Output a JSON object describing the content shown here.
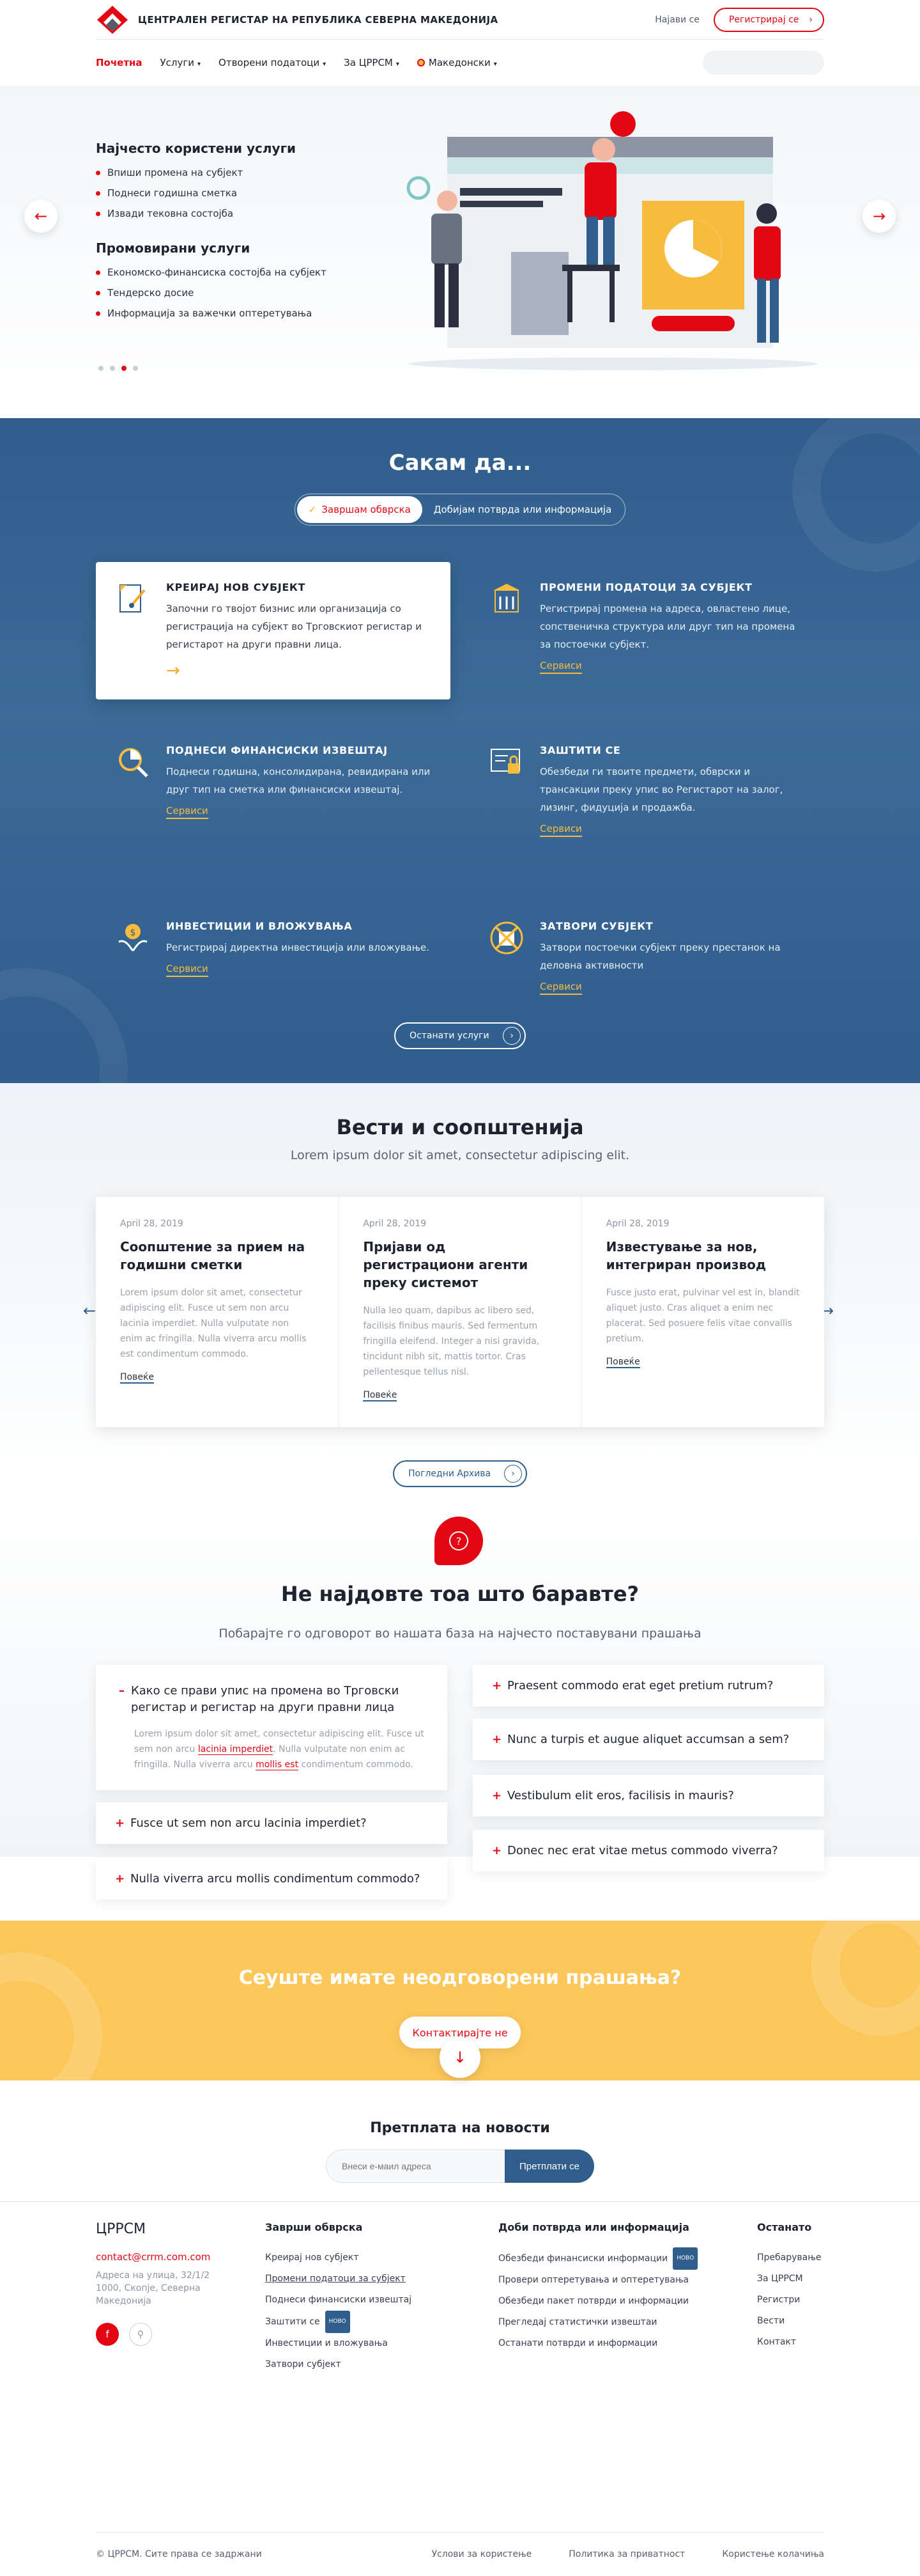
{
  "header": {
    "brand": "ЦЕНТРАЛЕН РЕГИСТАР НА РЕПУБЛИКА СЕВЕРНА МАКЕДОНИЈА",
    "login": "Најави се",
    "register": "Регистрирај се"
  },
  "nav": {
    "items": [
      "Почетна",
      "Услуги",
      "Отворени податоци",
      "За ЦРРСМ",
      "Македонски"
    ],
    "search_placeholder": ""
  },
  "hero": {
    "popular_title": "Најчесто користени услуги",
    "popular": [
      "Впиши промена на субјект",
      "Поднеси годишна сметка",
      "Извади тековна состојба"
    ],
    "promo_title": "Промовирани услуги",
    "promo": [
      "Економско-финансиска состојба на субјект",
      "Тендерско досие",
      "Информација за важечки оптеретувања"
    ]
  },
  "want": {
    "title": "Сакам да...",
    "tab_active": "Завршам обврска",
    "tab_other": "Добијам потврда или информација",
    "services": [
      {
        "title": "КРЕИРАЈ НОВ СУБЈЕКТ",
        "text": "Започни го твојот бизнис или организација со регистрација на субјект во Трговскиот регистар и регистарот на други правни лица.",
        "link": ""
      },
      {
        "title": "ПРОМЕНИ ПОДАТОЦИ ЗА СУБЈЕКТ",
        "text": "Регистрирај промена на адреса, овластено лице, сопственичка структура или друг тип на промена за постоечки субјект.",
        "link": "Сервиси"
      },
      {
        "title": "ПОДНЕСИ ФИНАНСИСКИ ИЗВЕШТАЈ",
        "text": "Поднеси годишна, консолидирана, ревидирана или друг тип на сметка или финансиски извештај.",
        "link": "Сервиси"
      },
      {
        "title": "ЗАШТИТИ СЕ",
        "text": "Обезбеди ги твоите предмети, обврски и трансакции преку упис во Регистарот на залог, лизинг, фидуција и продажба.",
        "link": "Сервиси"
      },
      {
        "title": "ИНВЕСТИЦИИ И ВЛОЖУВАЊА",
        "text": "Регистрирај директна инвестиција или вложување.",
        "link": "Сервиси"
      },
      {
        "title": "ЗАТВОРИ СУБЈЕКТ",
        "text": "Затвори постоечки субјект преку престанок на деловна активности",
        "link": "Сервиси"
      }
    ],
    "other_button": "Останати услуги"
  },
  "news": {
    "title": "Вести и соопштенија",
    "subtitle": "Lorem ipsum dolor sit amet, consectetur adipiscing elit.",
    "items": [
      {
        "date": "April 28, 2019",
        "title": "Соопштение за  прием на годишни сметки",
        "text": "Lorem ipsum dolor sit amet, consectetur adipiscing elit. Fusce ut sem non arcu lacinia imperdiet. Nulla vulputate non enim ac fringilla. Nulla viverra arcu mollis est condimentum commodo.",
        "more": "Повеќе"
      },
      {
        "date": "April 28, 2019",
        "title": "Пријави од регистрациони агенти преку системот",
        "text": "Nulla leo quam, dapibus ac libero sed, facilisis finibus mauris. Sed fermentum fringilla eleifend. Integer a nisi gravida, tincidunt nibh sit, mattis tortor. Cras pellentesque tellus nisl.",
        "more": "Повеќе"
      },
      {
        "date": "April 28, 2019",
        "title": "Известување за нов, интегриран производ",
        "text": "Fusce justo erat, pulvinar vel est in, blandit aliquet justo. Cras aliquet a enim nec placerat. Sed posuere felis vitae convallis pretium.",
        "more": "Повеќе"
      }
    ],
    "archive": "Погледни Архива"
  },
  "faq": {
    "title": "Не најдовте тоа што баравте?",
    "subtitle": "Побарајте го одговорот во нашата база на најчесто поставувани прашања",
    "open_q": "Како се прави упис на промена во Трговски регистар и регистар на други правни лица",
    "open_a1": "Lorem ipsum dolor sit amet, consectetur adipiscing elit. Fusce ut sem non arcu ",
    "open_a_hl1": "lacinia imperdiet",
    "open_a2": ". Nulla vulputate non enim ac fringilla. Nulla viverra arcu ",
    "open_a_hl2": "mollis est",
    "open_a3": " condimentum commodo.",
    "left": [
      "Fusce ut sem non arcu lacinia imperdiet?",
      "Nulla viverra arcu mollis condimentum commodo?"
    ],
    "right": [
      "Praesent commodo erat eget pretium rutrum?",
      "Nunc a turpis et augue aliquet accumsan a sem?",
      "Vestibulum elit eros, facilisis in mauris?",
      "Donec nec erat vitae metus commodo viverra?"
    ]
  },
  "cta": {
    "title": "Сеуште имате неодговорени прашања?",
    "button": "Контактирајте не"
  },
  "newsletter": {
    "title": "Претплата на новости",
    "placeholder": "Внеси е-маил адреса",
    "button": "Претплати се"
  },
  "footer": {
    "brand": "ЦРРСМ",
    "email": "contact@crrm.com.com",
    "address": "Адреса на улица, 32/1/2 1000, Скопје, Северна Македонија",
    "col1": {
      "title": "Заврши обврска",
      "links": [
        "Креирај нов субјект",
        "Промени податоци за субјект",
        "Поднеси финансиски извештај",
        "Заштити се",
        "Инвестиции и вложувања",
        "Затвори субјект"
      ],
      "new_on": 3
    },
    "col2": {
      "title": "Доби потврда или информација",
      "links": [
        "Обезбеди финансиски информации",
        "Провери оптеретувања и оптеретувања",
        "Обезбеди пакет потврди и информации",
        "Прегледај статистички извештаи",
        "Останати потврди и информации"
      ],
      "new_on": 0
    },
    "col3": {
      "title": "Останато",
      "links": [
        "Пребарување",
        "За ЦРРСМ",
        "Регистри",
        "Вести",
        "Контакт"
      ]
    },
    "badge_new": "НОВО",
    "copyright": "© ЦРРСМ. Сите права се задржани",
    "bottom_links": [
      "Услови за користење",
      "Политика за приватност",
      "Користење колачиња"
    ]
  },
  "colors": {
    "brand_red": "#e30613",
    "brand_blue": "#2f5d8c",
    "accent_yellow": "#fbc75a"
  }
}
